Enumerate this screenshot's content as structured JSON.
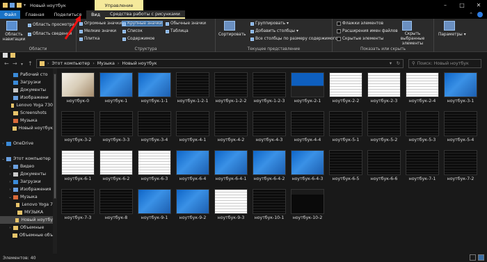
{
  "window": {
    "title": "Новый ноутбук",
    "contextual_tab": "Управление"
  },
  "tabs": [
    {
      "label": "Файл"
    },
    {
      "label": "Главная"
    },
    {
      "label": "Поделиться"
    },
    {
      "label": "Вид"
    },
    {
      "label": "Средства работы с рисунками"
    }
  ],
  "ribbon": {
    "panes": {
      "nav_pane": "Область навигации",
      "preview": "Область просмотра",
      "details": "Область сведений",
      "label": "Области"
    },
    "layout": {
      "huge": "Огромные значки",
      "large": "Крупные значки",
      "medium": "Обычные значки",
      "small": "Мелкие значки",
      "list": "Список",
      "table": "Таблица",
      "tiles": "Плитка",
      "content": "Содержимое",
      "label": "Структура"
    },
    "current_view": {
      "sort": "Сортировать",
      "group": "Группировать",
      "add_columns": "Добавить столбцы",
      "fit_columns": "Все столбцы по размеру содержимого",
      "label": "Текущее представление"
    },
    "show_hide": {
      "checkboxes": "Флажки элементов",
      "extensions": "Расширения имен файлов",
      "hidden": "Скрытые элементы",
      "hide_selected": "Скрыть выбранные элементы",
      "label": "Показать или скрыть"
    },
    "options": {
      "label": "Параметры"
    }
  },
  "address": {
    "breadcrumb": [
      "Этот компьютер",
      "Музыка",
      "Новый ноутбук"
    ],
    "search_placeholder": "Поиск: Новый ноутбук"
  },
  "sidebar": {
    "items": [
      {
        "label": "Рабочий сто",
        "icon": "desktop-icon"
      },
      {
        "label": "Загрузки",
        "icon": "downloads-icon"
      },
      {
        "label": "Документы",
        "icon": "documents-icon"
      },
      {
        "label": "Изображени",
        "icon": "pictures-icon"
      },
      {
        "label": "Lenovo Yoga 730",
        "icon": "folder-icon"
      },
      {
        "label": "Screenshots",
        "icon": "folder-icon"
      },
      {
        "label": "Музыка",
        "icon": "music-icon"
      },
      {
        "label": "Новый ноутбук",
        "icon": "folder-icon"
      },
      {
        "label": "OneDrive",
        "icon": "cloud-icon"
      },
      {
        "label": "Этот компьютер",
        "icon": "computer-icon"
      },
      {
        "label": "Видео",
        "icon": "video-icon"
      },
      {
        "label": "Документы",
        "icon": "documents-icon"
      },
      {
        "label": "Загрузки",
        "icon": "downloads-icon"
      },
      {
        "label": "Изображения",
        "icon": "pictures-icon"
      },
      {
        "label": "Музыка",
        "icon": "music-icon"
      },
      {
        "label": "Lenovo Yoga 7",
        "icon": "folder-icon"
      },
      {
        "label": "МУЗЫКА",
        "icon": "folder-icon"
      },
      {
        "label": "Новый ноутбу",
        "icon": "folder-icon"
      },
      {
        "label": "Объемные",
        "icon": "folder-icon"
      },
      {
        "label": "Объемные объ",
        "icon": "folder-icon"
      }
    ]
  },
  "files": [
    "ноутбук-0",
    "ноутбук-1",
    "ноутбук-1-1",
    "ноутбук-1-2-1",
    "ноутбук-1-2-2",
    "ноутбук-1-2-3",
    "ноутбук-2-1",
    "ноутбук-2-2",
    "ноутбук-2-3",
    "ноутбук-2-4",
    "ноутбук-3-1",
    "ноутбук-3-2",
    "ноутбук-3-3",
    "ноутбук-3-4",
    "ноутбук-4-1",
    "ноутбук-4-2",
    "ноутбук-4-3",
    "ноутбук-4-4",
    "ноутбук-5-1",
    "ноутбук-5-2",
    "ноутбук-5-3",
    "ноутбук-5-4",
    "ноутбук-6-1",
    "ноутбук-6-2",
    "ноутбук-6-3",
    "ноутбук-6-4",
    "ноутбук-6-4-1",
    "ноутбук-6-4-2",
    "ноутбук-6-4-3",
    "ноутбук-6-5",
    "ноутбук-6-6",
    "ноутбук-7-1",
    "ноутбук-7-2",
    "ноутбук-7-3",
    "ноутбук-8",
    "ноутбук-9-1",
    "ноутбук-9-2",
    "ноутбук-9-3",
    "ноутбук-10-1",
    "ноутбук-10-2"
  ],
  "status": {
    "count": "Элементов: 40"
  }
}
